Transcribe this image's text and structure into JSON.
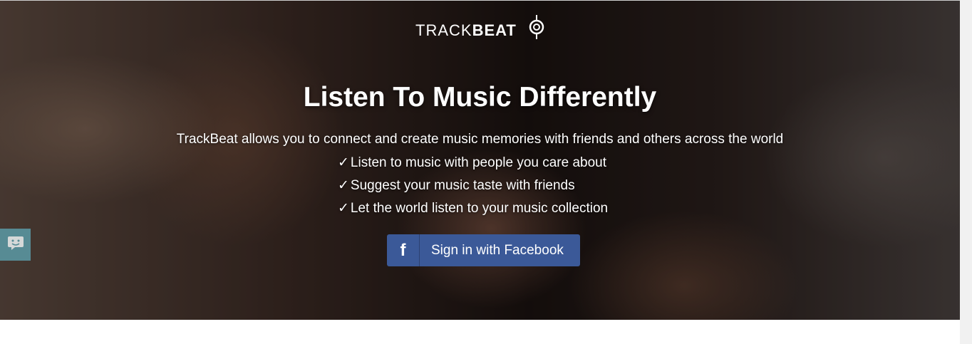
{
  "logo": {
    "light": "TRACK",
    "bold": "BEAT",
    "icon": "target-logo-icon"
  },
  "hero": {
    "headline": "Listen To Music Differently",
    "subtitle": "TrackBeat allows you to connect and create music memories with friends and others across the world",
    "features": [
      "Listen to music with people you care about",
      "Suggest your music taste with friends",
      "Let the world listen to your music collection"
    ],
    "check": "✓"
  },
  "facebook_button": {
    "icon": "f",
    "label": "Sign in with Facebook",
    "color": "#3b5998"
  },
  "chat_widget": {
    "icon": "chat-bubble-icon",
    "color": "#5b9aa6"
  }
}
